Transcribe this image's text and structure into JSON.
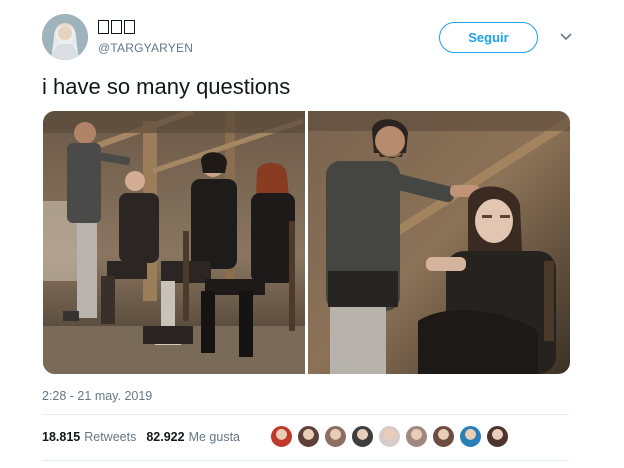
{
  "header": {
    "handle": "@TARGYARYEN",
    "follow_label": "Seguir"
  },
  "tweet": {
    "text": "i have so many questions",
    "timestamp": "2:28 - 21 may. 2019"
  },
  "stats": {
    "retweets_count": "18.815",
    "retweets_label": "Retweets",
    "likes_count": "82.922",
    "likes_label": "Me gusta"
  },
  "icons": {
    "chevron": "chevron-down-icon"
  },
  "colors": {
    "accent": "#1da1f2",
    "muted": "#657786",
    "text": "#14171a"
  },
  "likers": [
    {
      "color": "#c0392b"
    },
    {
      "color": "#5d4037"
    },
    {
      "color": "#8d6e63"
    },
    {
      "color": "#3e3e3e"
    },
    {
      "color": "#d7ccc8"
    },
    {
      "color": "#a1887f"
    },
    {
      "color": "#6d4c41"
    },
    {
      "color": "#2980b9"
    },
    {
      "color": "#4e342e"
    }
  ]
}
